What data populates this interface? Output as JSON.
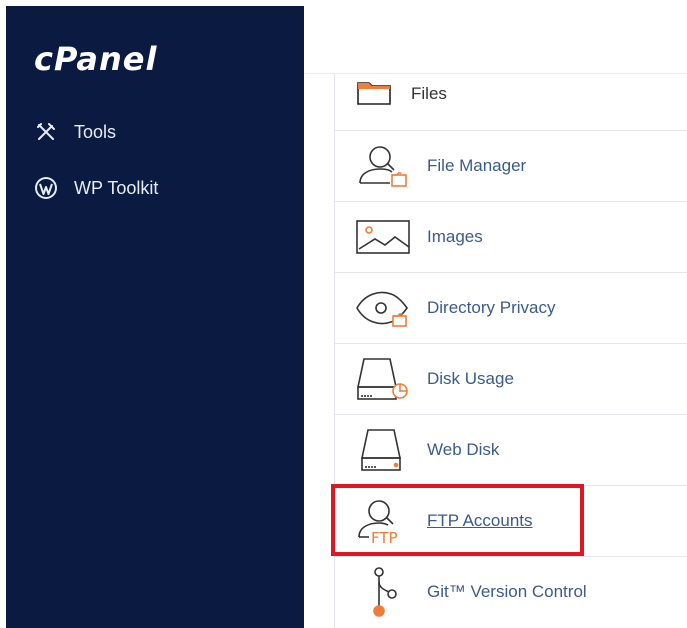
{
  "sidebar": {
    "logo": "cPanel",
    "items": [
      {
        "label": "Tools",
        "icon": "tools-icon"
      },
      {
        "label": "WP Toolkit",
        "icon": "wordpress-icon"
      }
    ]
  },
  "files": {
    "header": "Files",
    "items": [
      {
        "label": "File Manager",
        "icon": "file-manager-icon"
      },
      {
        "label": "Images",
        "icon": "images-icon"
      },
      {
        "label": "Directory Privacy",
        "icon": "directory-privacy-icon"
      },
      {
        "label": "Disk Usage",
        "icon": "disk-usage-icon"
      },
      {
        "label": "Web Disk",
        "icon": "web-disk-icon"
      },
      {
        "label": "FTP Accounts",
        "icon": "ftp-accounts-icon",
        "ftp_text": "FTP"
      },
      {
        "label": "Git™ Version Control",
        "icon": "git-icon"
      }
    ]
  },
  "colors": {
    "sidebar_bg": "#0a1a41",
    "accent_orange": "#f07c3a",
    "link_blue": "#3b5b8c",
    "highlight_red": "#e0171f"
  }
}
